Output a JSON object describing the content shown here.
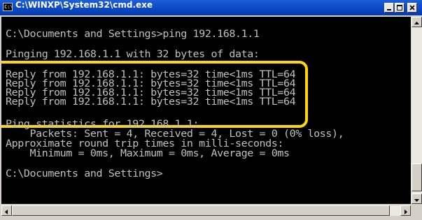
{
  "window": {
    "title": "C:\\WINXP\\System32\\cmd.exe",
    "icon_label": "C:\\"
  },
  "console": {
    "lines": [
      "C:\\Documents and Settings>ping 192.168.1.1",
      "Pinging 192.168.1.1 with 32 bytes of data:",
      "Reply from 192.168.1.1: bytes=32 time<1ms TTL=64",
      "Reply from 192.168.1.1: bytes=32 time<1ms TTL=64",
      "Reply from 192.168.1.1: bytes=32 time<1ms TTL=64",
      "Reply from 192.168.1.1: bytes=32 time<1ms TTL=64",
      "Ping statistics for 192.168.1.1:",
      "    Packets: Sent = 4, Received = 4, Lost = 0 (0% loss),",
      "Approximate round trip times in milli-seconds:",
      "    Minimum = 0ms, Maximum = 0ms, Average = 0ms",
      "C:\\Documents and Settings>"
    ]
  },
  "icons": {
    "minimize": "minimize-icon",
    "maximize": "maximize-icon",
    "close": "close-icon"
  },
  "colors": {
    "titlebar": "#0a46c4",
    "console_bg": "#000000",
    "console_text": "#c0c0c0",
    "highlight": "#ffd700"
  }
}
